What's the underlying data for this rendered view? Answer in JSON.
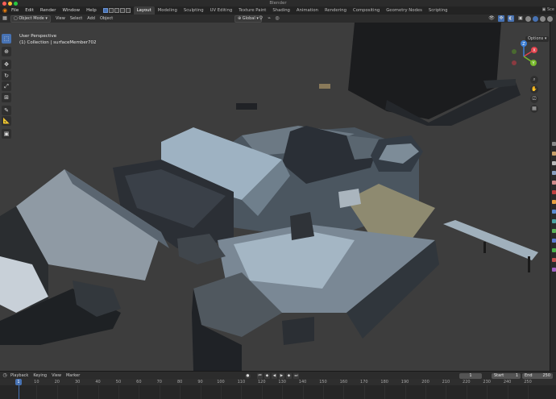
{
  "window": {
    "title": "Blender"
  },
  "colors": {
    "accent": "#4772b3",
    "brand": "#e87d0d",
    "close": "#ff5f57",
    "minimize": "#febc2e",
    "maximize": "#28c840",
    "axis_x": "#e2434d",
    "axis_y": "#76b82a",
    "axis_z": "#3c7fd6"
  },
  "topbar": {
    "menu": [
      "File",
      "Edit",
      "Render",
      "Window",
      "Help"
    ],
    "workspaces": [
      "Layout",
      "Modeling",
      "Sculpting",
      "UV Editing",
      "Texture Paint",
      "Shading",
      "Animation",
      "Rendering",
      "Compositing",
      "Geometry Nodes",
      "Scripting"
    ],
    "active_workspace": "Layout",
    "scene_label": "Sce"
  },
  "viewport_header": {
    "mode": "Object Mode",
    "menu": [
      "View",
      "Select",
      "Add",
      "Object"
    ],
    "transform_orientation": "Global",
    "options_label": "Options"
  },
  "viewport": {
    "view_name": "User Perspective",
    "collection_info": "(1) Collection | surfaceMember702",
    "gizmo": {
      "x": "X",
      "y": "Y",
      "z": "Z"
    }
  },
  "tools": [
    "select-box-icon",
    "cursor-icon",
    "move-icon",
    "rotate-icon",
    "scale-icon",
    "transform-icon",
    "annotate-icon",
    "measure-icon",
    "add-cube-icon"
  ],
  "timeline": {
    "menu": [
      "Playback",
      "Keying",
      "View",
      "Marker"
    ],
    "current_frame": "1",
    "start_label": "Start",
    "start": "1",
    "end_label": "End",
    "end": "250",
    "ruler_ticks": [
      "1",
      "10",
      "20",
      "30",
      "40",
      "50",
      "60",
      "70",
      "80",
      "90",
      "100",
      "110",
      "120",
      "130",
      "140",
      "150",
      "160",
      "170",
      "180",
      "190",
      "200",
      "210",
      "220",
      "230",
      "240",
      "250"
    ]
  }
}
